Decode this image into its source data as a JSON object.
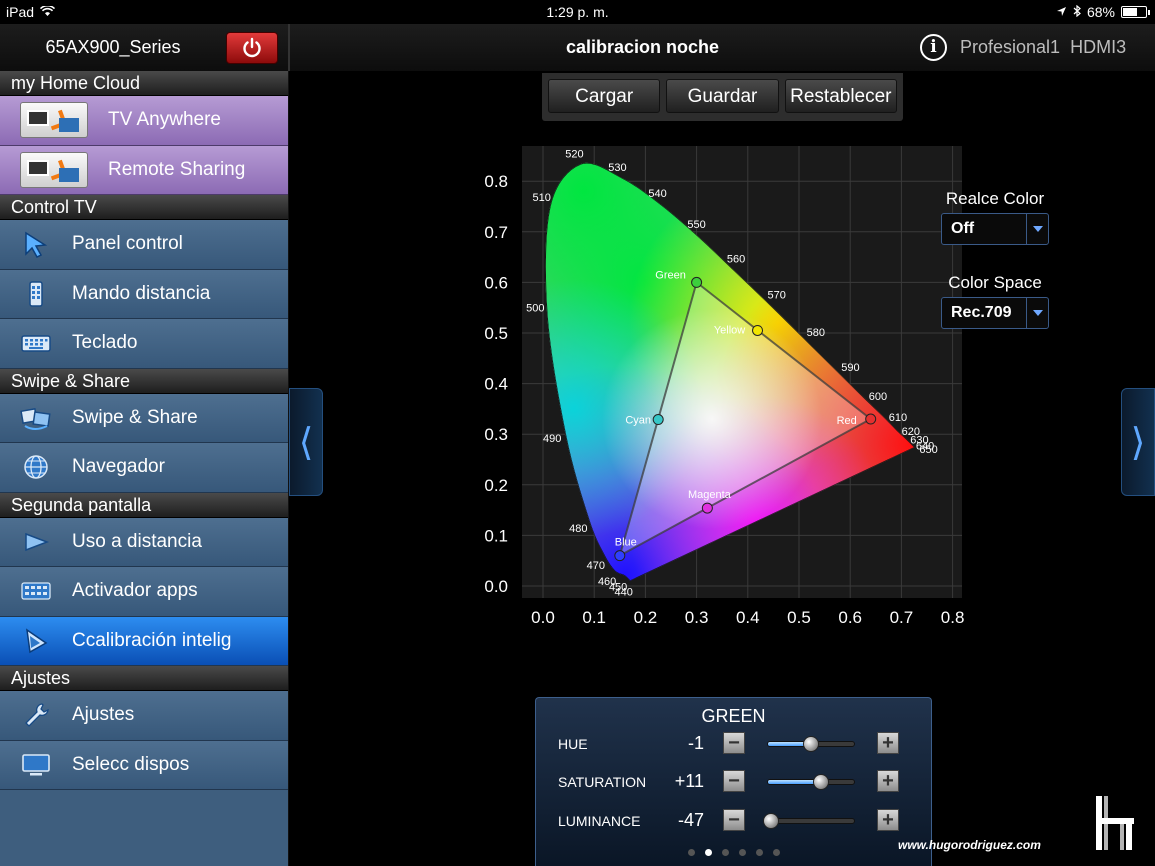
{
  "status_bar": {
    "carrier": "iPad",
    "time": "1:29 p. m.",
    "battery": "68%"
  },
  "header": {
    "device_name": "65AX900_Series",
    "title": "calibracion noche",
    "profile": "Profesional1",
    "input": "HDMI3"
  },
  "sidebar": {
    "sections": [
      {
        "title": "my Home Cloud",
        "items": [
          {
            "label": "TV Anywhere",
            "icon": "tv-anywhere-icon"
          },
          {
            "label": "Remote Sharing",
            "icon": "remote-sharing-icon"
          }
        ]
      },
      {
        "title": "Control TV",
        "items": [
          {
            "label": "Panel control",
            "icon": "pointer-arrow-icon"
          },
          {
            "label": "Mando distancia",
            "icon": "remote-control-icon"
          },
          {
            "label": "Teclado",
            "icon": "keyboard-icon"
          }
        ]
      },
      {
        "title": "Swipe & Share",
        "items": [
          {
            "label": "Swipe & Share",
            "icon": "swipe-share-icon"
          },
          {
            "label": "Navegador",
            "icon": "globe-icon"
          }
        ]
      },
      {
        "title": "Segunda pantalla",
        "items": [
          {
            "label": "Uso a distancia",
            "icon": "remote-use-icon"
          },
          {
            "label": "Activador apps",
            "icon": "apps-grid-icon"
          },
          {
            "label": "Ccalibración intelig",
            "icon": "calibration-icon"
          }
        ]
      },
      {
        "title": "Ajustes",
        "items": [
          {
            "label": "Ajustes",
            "icon": "wrench-icon"
          },
          {
            "label": "Selecc dispos",
            "icon": "monitor-icon"
          }
        ]
      }
    ]
  },
  "toolbar": {
    "load_label": "Cargar",
    "save_label": "Guardar",
    "reset_label": "Restablecer"
  },
  "options": {
    "color_enhance": {
      "label": "Realce Color",
      "value": "Off"
    },
    "color_space": {
      "label": "Color Space",
      "value": "Rec.709"
    }
  },
  "chart_data": {
    "type": "scatter",
    "title": "",
    "xlabel": "",
    "ylabel": "",
    "xlim": [
      0.0,
      0.8
    ],
    "ylim": [
      0.0,
      0.8
    ],
    "x_ticks": [
      "0.0",
      "0.1",
      "0.2",
      "0.3",
      "0.4",
      "0.5",
      "0.6",
      "0.7",
      "0.8"
    ],
    "y_ticks": [
      "0.0",
      "0.1",
      "0.2",
      "0.3",
      "0.4",
      "0.5",
      "0.6",
      "0.7",
      "0.8"
    ],
    "grid": true,
    "locus_labels": [
      {
        "label": "440",
        "x": 0.17,
        "y": 0.01
      },
      {
        "label": "450",
        "x": 0.16,
        "y": 0.02
      },
      {
        "label": "460",
        "x": 0.14,
        "y": 0.03
      },
      {
        "label": "470",
        "x": 0.12,
        "y": 0.06
      },
      {
        "label": "480",
        "x": 0.09,
        "y": 0.13
      },
      {
        "label": "490",
        "x": 0.045,
        "y": 0.295
      },
      {
        "label": "500",
        "x": 0.008,
        "y": 0.538
      },
      {
        "label": "510",
        "x": 0.014,
        "y": 0.75
      },
      {
        "label": "520",
        "x": 0.074,
        "y": 0.834
      },
      {
        "label": "530",
        "x": 0.155,
        "y": 0.806
      },
      {
        "label": "540",
        "x": 0.23,
        "y": 0.754
      },
      {
        "label": "550",
        "x": 0.302,
        "y": 0.692
      },
      {
        "label": "560",
        "x": 0.373,
        "y": 0.624
      },
      {
        "label": "570",
        "x": 0.444,
        "y": 0.555
      },
      {
        "label": "580",
        "x": 0.512,
        "y": 0.487
      },
      {
        "label": "590",
        "x": 0.575,
        "y": 0.424
      },
      {
        "label": "600",
        "x": 0.627,
        "y": 0.372
      },
      {
        "label": "610",
        "x": 0.666,
        "y": 0.334
      },
      {
        "label": "620",
        "x": 0.691,
        "y": 0.308
      },
      {
        "label": "630",
        "x": 0.708,
        "y": 0.292
      },
      {
        "label": "640",
        "x": 0.719,
        "y": 0.281
      },
      {
        "label": "650",
        "x": 0.726,
        "y": 0.274
      }
    ],
    "points": [
      {
        "label": "Green",
        "x": 0.3,
        "y": 0.6,
        "color": "#3ccf3c"
      },
      {
        "label": "Yellow",
        "x": 0.419,
        "y": 0.505,
        "color": "#f2e600"
      },
      {
        "label": "Red",
        "x": 0.64,
        "y": 0.33,
        "color": "#e53030"
      },
      {
        "label": "Cyan",
        "x": 0.225,
        "y": 0.329,
        "color": "#36c7c7"
      },
      {
        "label": "Magenta",
        "x": 0.321,
        "y": 0.154,
        "color": "#e032e0"
      },
      {
        "label": "Blue",
        "x": 0.15,
        "y": 0.06,
        "color": "#3040ff"
      }
    ]
  },
  "adjust_panel": {
    "title": "GREEN",
    "rows": [
      {
        "label": "HUE",
        "value": "-1",
        "level": 0.5
      },
      {
        "label": "SATURATION",
        "value": "+11",
        "level": 0.62
      },
      {
        "label": "LUMINANCE",
        "value": "-47",
        "level": 0.03
      }
    ],
    "page_count": 6,
    "active_page": 2
  },
  "watermark": "www.hugorodriguez.com",
  "colors": {
    "accent": "#0a6de0",
    "sidebar": "#3e5e7e",
    "purple": "#a080c8",
    "power": "#d02020"
  }
}
